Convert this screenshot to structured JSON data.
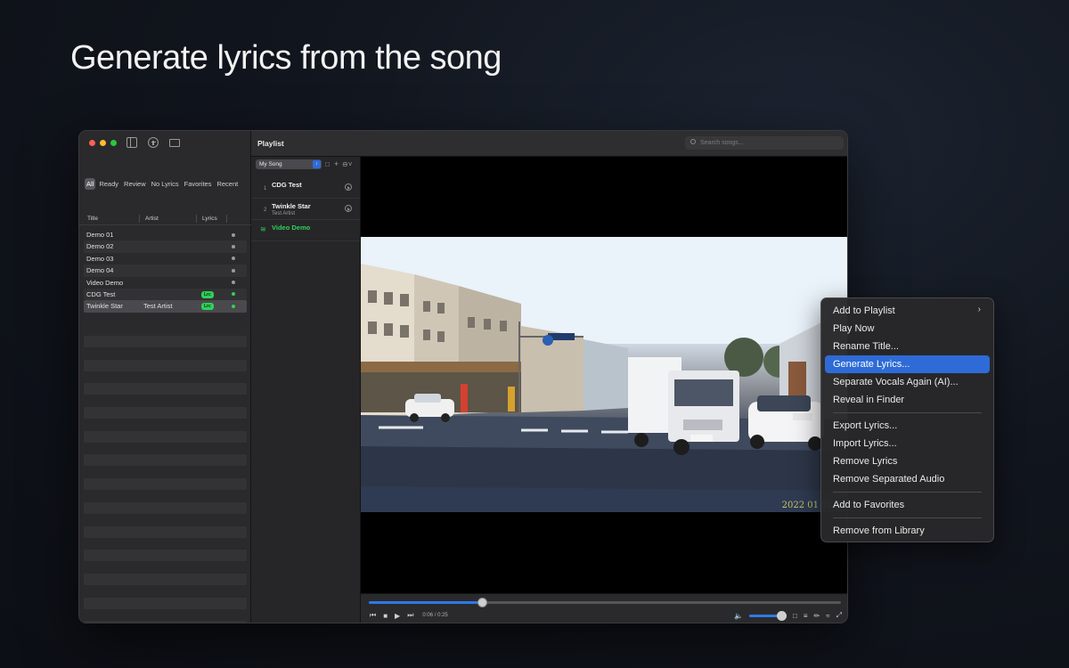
{
  "headline": "Generate lyrics from the song",
  "sidebar": {
    "filters": [
      "All",
      "Ready",
      "Review",
      "No Lyrics",
      "Favorites",
      "Recent"
    ],
    "active_filter": "All",
    "columns": {
      "title": "Title",
      "artist": "Artist",
      "lyrics": "Lyrics"
    },
    "songs": [
      {
        "title": "Demo 01",
        "artist": "",
        "lrc": "",
        "status": "none"
      },
      {
        "title": "Demo 02",
        "artist": "",
        "lrc": "",
        "status": "none"
      },
      {
        "title": "Demo 03",
        "artist": "",
        "lrc": "",
        "status": "none"
      },
      {
        "title": "Demo 04",
        "artist": "",
        "lrc": "",
        "status": "none"
      },
      {
        "title": "Video Demo",
        "artist": "",
        "lrc": "",
        "status": "none"
      },
      {
        "title": "CDG Test",
        "artist": "",
        "lrc": "Lrc",
        "status": "ok"
      },
      {
        "title": "Twinkle Star",
        "artist": "Test Artist",
        "lrc": "Lrc",
        "status": "ok"
      }
    ]
  },
  "toolbar": {
    "title": "Playlist",
    "search_placeholder": "Search songs..."
  },
  "playlist": {
    "selected": "My Song",
    "items": [
      {
        "num": "1",
        "name": "CDG Test",
        "artist": "",
        "playing": false
      },
      {
        "num": "2",
        "name": "Twinkle Star",
        "artist": "Test Artist",
        "playing": false
      },
      {
        "num": "",
        "name": "Video Demo",
        "artist": "",
        "playing": true
      }
    ]
  },
  "video": {
    "timestamp": "2022 01 12/16"
  },
  "transport": {
    "time": "0:06 / 0:25",
    "progress": 0.24,
    "volume": 0.85
  },
  "context_menu": {
    "groups": [
      [
        {
          "label": "Add to Playlist",
          "submenu": true,
          "highlighted": false
        },
        {
          "label": "Play Now",
          "submenu": false,
          "highlighted": false
        },
        {
          "label": "Rename Title...",
          "submenu": false,
          "highlighted": false
        },
        {
          "label": "Generate Lyrics...",
          "submenu": false,
          "highlighted": true
        },
        {
          "label": "Separate Vocals Again (AI)...",
          "submenu": false,
          "highlighted": false
        },
        {
          "label": "Reveal in Finder",
          "submenu": false,
          "highlighted": false
        }
      ],
      [
        {
          "label": "Export Lyrics...",
          "submenu": false,
          "highlighted": false
        },
        {
          "label": "Import Lyrics...",
          "submenu": false,
          "highlighted": false
        },
        {
          "label": "Remove Lyrics",
          "submenu": false,
          "highlighted": false
        },
        {
          "label": "Remove Separated Audio",
          "submenu": false,
          "highlighted": false
        }
      ],
      [
        {
          "label": "Add to Favorites",
          "submenu": false,
          "highlighted": false
        }
      ],
      [
        {
          "label": "Remove from Library",
          "submenu": false,
          "highlighted": false
        }
      ]
    ]
  },
  "colors": {
    "accent": "#2e6bd6",
    "status_green": "#30d158"
  }
}
